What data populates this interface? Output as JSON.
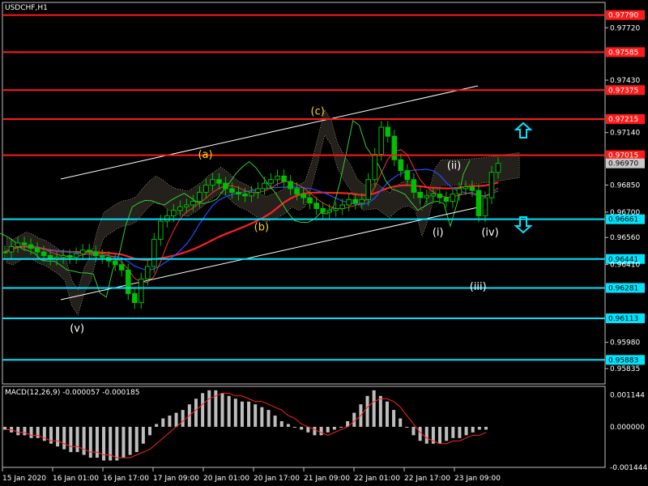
{
  "chart_data": [
    {
      "type": "candlestick",
      "title": "USDCHF,H1",
      "ylim": [
        0.9575,
        0.9786
      ],
      "price_ticks": [
        "0.97720",
        "0.97430",
        "0.97140",
        "0.96850",
        "0.96700",
        "0.96560",
        "0.96410",
        "0.95980",
        "0.95835"
      ],
      "time_ticks": [
        "15 Jan 2020",
        "16 Jan 01:00",
        "16 Jan 17:00",
        "17 Jan 09:00",
        "20 Jan 01:00",
        "20 Jan 17:00",
        "21 Jan 09:00",
        "22 Jan 01:00",
        "22 Jan 17:00",
        "23 Jan 09:00"
      ],
      "resistance_levels": [
        {
          "label": "0.97790",
          "value": 0.9779
        },
        {
          "label": "0.97585",
          "value": 0.97585
        },
        {
          "label": "0.97375",
          "value": 0.97375
        },
        {
          "label": "0.97215",
          "value": 0.97215
        },
        {
          "label": "0.97015",
          "value": 0.97015
        }
      ],
      "support_levels": [
        {
          "label": "0.96661",
          "value": 0.96661
        },
        {
          "label": "0.96441",
          "value": 0.96441
        },
        {
          "label": "0.96281",
          "value": 0.96281
        },
        {
          "label": "0.96113",
          "value": 0.96113
        },
        {
          "label": "0.95883",
          "value": 0.95883
        }
      ],
      "current_price": {
        "label": "0.96970",
        "value": 0.9697
      },
      "wave_labels": [
        {
          "text": "(v)",
          "color": "#ffffff"
        },
        {
          "text": "(a)",
          "color": "#ffd700"
        },
        {
          "text": "(b)",
          "color": "#ffd700"
        },
        {
          "text": "(c)",
          "color": "#ffd700"
        },
        {
          "text": "(i)",
          "color": "#ffffff"
        },
        {
          "text": "(ii)",
          "color": "#ffffff"
        },
        {
          "text": "(iii)",
          "color": "#ffffff"
        },
        {
          "text": "(iv)",
          "color": "#ffffff"
        }
      ],
      "closes": [
        0.9648,
        0.9651,
        0.9653,
        0.9652,
        0.965,
        0.9648,
        0.9646,
        0.9644,
        0.9645,
        0.9646,
        0.9645,
        0.9647,
        0.9649,
        0.9648,
        0.9646,
        0.9645,
        0.9643,
        0.9641,
        0.9638,
        0.9625,
        0.962,
        0.9633,
        0.964,
        0.9655,
        0.9665,
        0.9668,
        0.9671,
        0.9673,
        0.9674,
        0.9676,
        0.9681,
        0.9685,
        0.9688,
        0.9686,
        0.9683,
        0.9681,
        0.968,
        0.9679,
        0.9681,
        0.9683,
        0.9686,
        0.9688,
        0.969,
        0.9687,
        0.9683,
        0.968,
        0.9678,
        0.9675,
        0.9672,
        0.967,
        0.9671,
        0.9672,
        0.9674,
        0.9677,
        0.9675,
        0.9677,
        0.9688,
        0.9702,
        0.9717,
        0.9712,
        0.9699,
        0.9693,
        0.9688,
        0.9681,
        0.9678,
        0.9679,
        0.968,
        0.9678,
        0.9676,
        0.968,
        0.9683,
        0.9684,
        0.9682,
        0.9668,
        0.9678,
        0.9692,
        0.9697
      ]
    },
    {
      "type": "histogram",
      "title": "MACD(12,26,9) -0.000057 -0.000185",
      "ylim": [
        -0.001444,
        0.00144
      ],
      "tick_labels": [
        "0.001144",
        "0.000000",
        "-0.001444"
      ],
      "histogram": [
        -0.0001,
        -0.0002,
        -0.0003,
        -0.0003,
        -0.0004,
        -0.0004,
        -0.0005,
        -0.0006,
        -0.0007,
        -0.0008,
        -0.0009,
        -0.0009,
        -0.001,
        -0.0011,
        -0.0011,
        -0.0012,
        -0.0012,
        -0.0012,
        -0.0011,
        -0.001,
        -0.0009,
        -0.0006,
        -0.0003,
        0.0001,
        0.0003,
        0.0004,
        0.0005,
        0.0006,
        0.0008,
        0.001,
        0.0012,
        0.0013,
        0.0013,
        0.0012,
        0.0011,
        0.001,
        0.0009,
        0.0009,
        0.0008,
        0.0007,
        0.0006,
        0.0004,
        0.0002,
        0.0001,
        0.0,
        -0.0001,
        -0.0002,
        -0.0003,
        -0.0003,
        -0.0002,
        -0.0001,
        0.0,
        0.0002,
        0.0005,
        0.0008,
        0.0011,
        0.0013,
        0.0011,
        0.0009,
        0.0006,
        0.0003,
        0.0,
        -0.0003,
        -0.0005,
        -0.0006,
        -0.0006,
        -0.0006,
        -0.0005,
        -0.0004,
        -0.0004,
        -0.0003,
        -0.0002,
        -0.0001,
        -0.0001
      ],
      "signal": [
        -0.0001,
        -0.0001,
        -0.0002,
        -0.0002,
        -0.0003,
        -0.0003,
        -0.0004,
        -0.0005,
        -0.0005,
        -0.0006,
        -0.0007,
        -0.0007,
        -0.0008,
        -0.0009,
        -0.0009,
        -0.001,
        -0.001,
        -0.0011,
        -0.0011,
        -0.0011,
        -0.001,
        -0.0009,
        -0.0008,
        -0.0006,
        -0.0004,
        -0.0002,
        0.0,
        0.0002,
        0.0004,
        0.0006,
        0.0008,
        0.001,
        0.0011,
        0.0012,
        0.0012,
        0.0011,
        0.0011,
        0.001,
        0.0009,
        0.0009,
        0.0008,
        0.0007,
        0.0006,
        0.0004,
        0.0003,
        0.0001,
        0.0,
        -0.0001,
        -0.0002,
        -0.0003,
        -0.0002,
        -0.0001,
        0.0,
        0.0002,
        0.0004,
        0.0007,
        0.0009,
        0.001,
        0.001,
        0.0009,
        0.0007,
        0.0004,
        0.0001,
        -0.0002,
        -0.0004,
        -0.0005,
        -0.0006,
        -0.0006,
        -0.0005,
        -0.0005,
        -0.0004,
        -0.0003,
        -0.0003,
        -0.0002
      ]
    }
  ],
  "ui": {
    "symbol_label": "USDCHF,H1"
  }
}
